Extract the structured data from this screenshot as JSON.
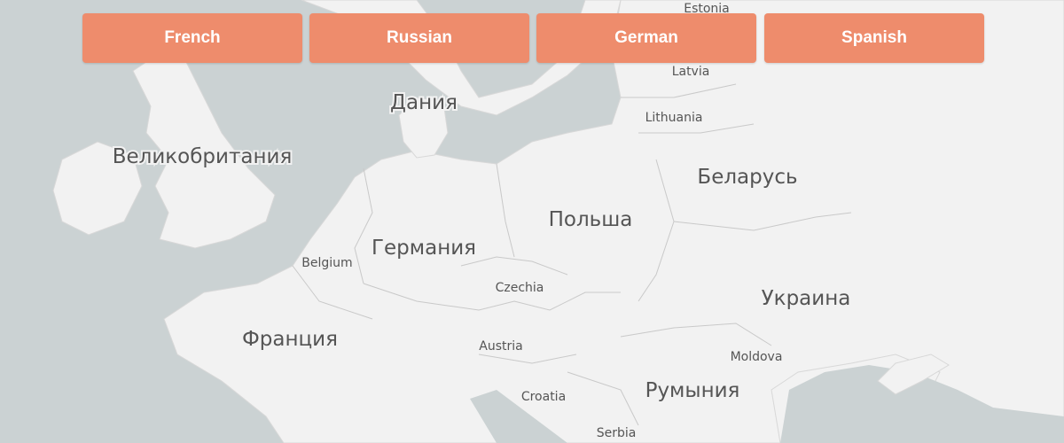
{
  "buttons": [
    {
      "label": "French"
    },
    {
      "label": "Russian"
    },
    {
      "label": "German"
    },
    {
      "label": "Spanish"
    }
  ],
  "map": {
    "countries": {
      "estonia": "Estonia",
      "latvia": "Latvia",
      "lithuania": "Lithuania",
      "denmark": "Дания",
      "uk": "Великобритания",
      "belarus": "Беларусь",
      "poland": "Польша",
      "germany": "Германия",
      "belgium": "Belgium",
      "czechia": "Czechia",
      "ukraine": "Украина",
      "france": "Франция",
      "austria": "Austria",
      "moldova": "Moldova",
      "romania": "Румыния",
      "croatia": "Croatia",
      "serbia": "Serbia"
    }
  },
  "colors": {
    "water": "#cbd2d3",
    "land": "#f2f2f2",
    "button": "#ee8c6c"
  }
}
